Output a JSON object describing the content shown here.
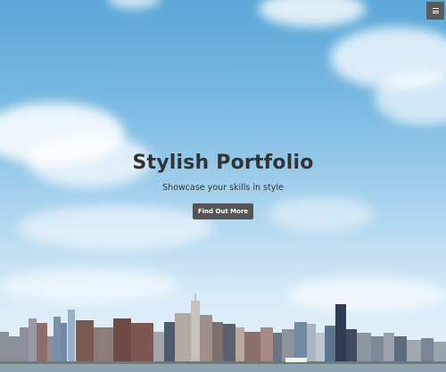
{
  "nav": {
    "menu_icon": "hamburger-menu-icon"
  },
  "hero": {
    "title": "Stylish Portfolio",
    "subtitle": "Showcase your skills in style",
    "button_label": "Find Out More"
  },
  "colors": {
    "sky_top": "#5aa7d8",
    "sky_bottom": "#e9f3f9",
    "text": "#333333",
    "button_bg": "#555555",
    "button_text": "#ffffff",
    "menu_bg": "#5b5b5b"
  }
}
